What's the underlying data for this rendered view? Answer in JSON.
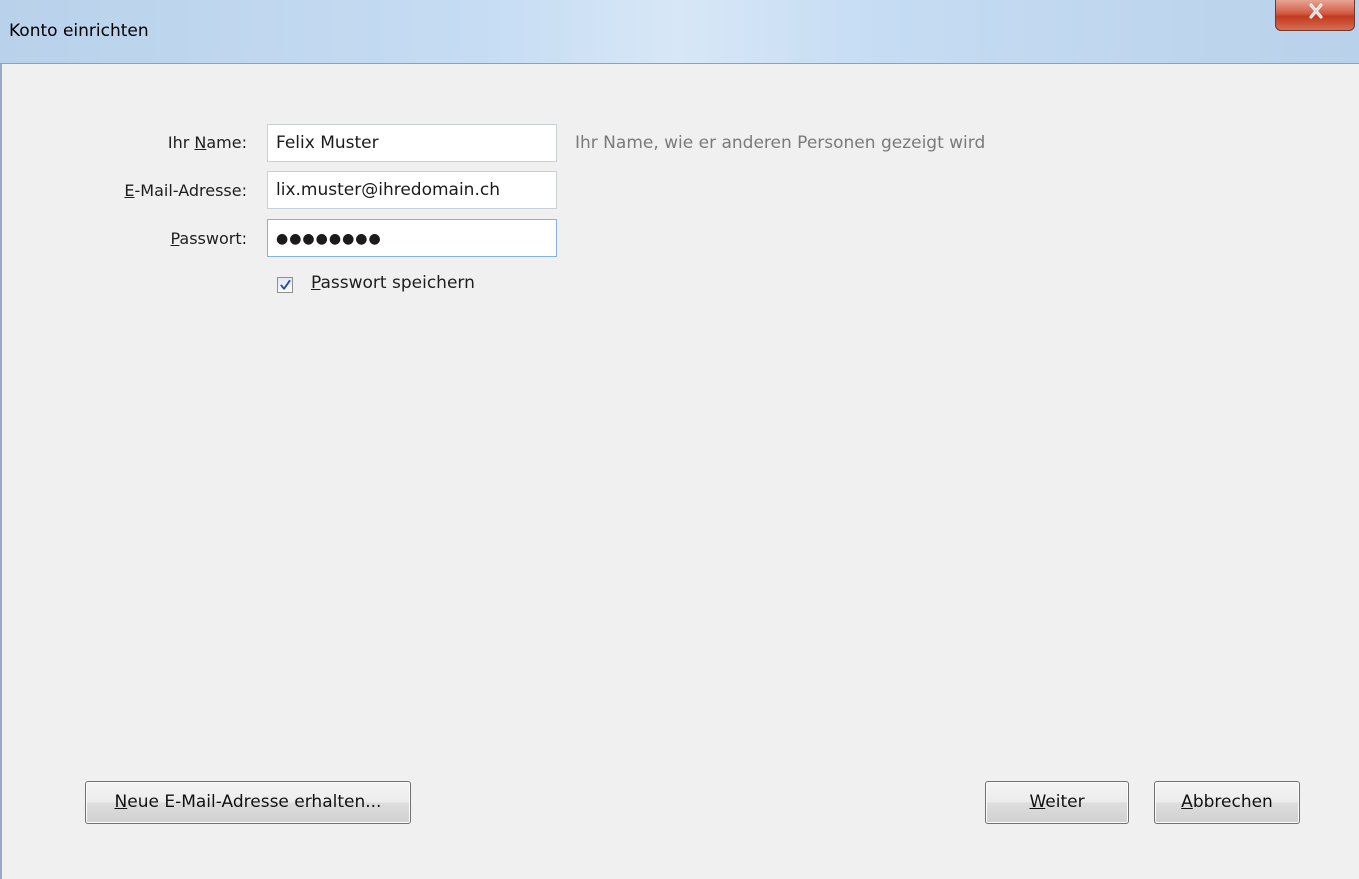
{
  "window": {
    "title": "Konto einrichten"
  },
  "form": {
    "name": {
      "label_before": "Ihr ",
      "label_underline": "N",
      "label_after": "ame:",
      "value": "Felix Muster",
      "hint": "Ihr Name, wie er anderen Personen gezeigt wird"
    },
    "email": {
      "label_before": "",
      "label_underline": "E",
      "label_after": "-Mail-Adresse:",
      "value": "lix.muster@ihredomain.ch"
    },
    "password": {
      "label_before": "",
      "label_underline": "P",
      "label_after": "asswort:",
      "value": "●●●●●●●●"
    },
    "save_password": {
      "checked": true,
      "label_underline": "P",
      "label_after": "asswort speichern"
    }
  },
  "buttons": {
    "new_address": {
      "underline": "N",
      "rest": "eue E-Mail-Adresse erhalten..."
    },
    "next": {
      "underline": "W",
      "rest": "eiter"
    },
    "cancel": {
      "underline": "A",
      "rest": "bbrechen"
    }
  },
  "icons": {
    "close": "close-icon",
    "check": "checkmark-icon"
  },
  "colors": {
    "close_button": "#c13a1f",
    "hint_text": "#7a7a7a",
    "focus_border": "#7eb4ea",
    "check": "#2a4f9a"
  }
}
